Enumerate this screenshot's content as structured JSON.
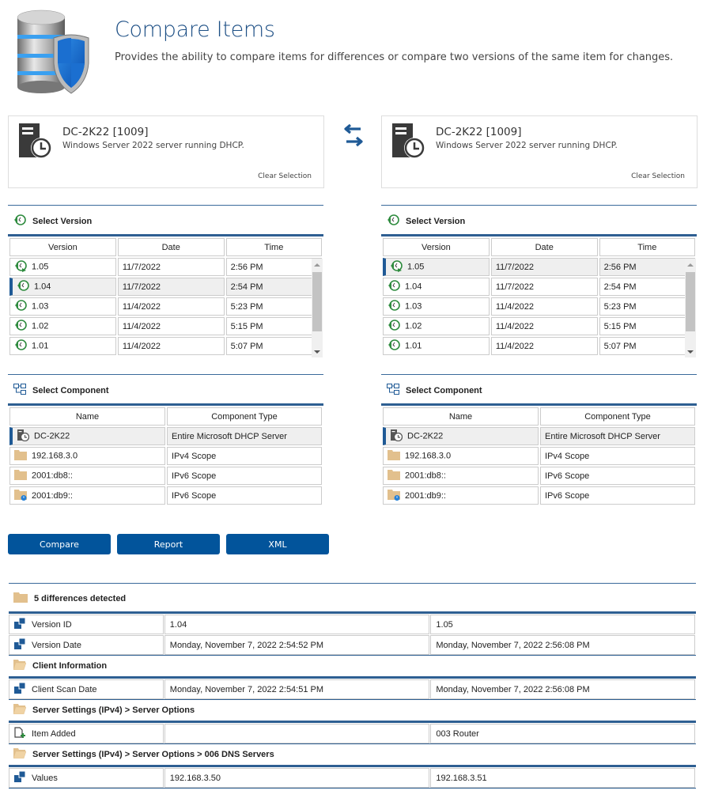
{
  "header": {
    "title": "Compare Items",
    "subtitle": "Provides the ability to compare items for differences or compare two versions of the same item for changes."
  },
  "left_item": {
    "name": "DC-2K22 [1009]",
    "description": "Windows Server 2022 server running DHCP.",
    "clear_label": "Clear Selection"
  },
  "right_item": {
    "name": "DC-2K22 [1009]",
    "description": "Windows Server 2022 server running DHCP.",
    "clear_label": "Clear Selection"
  },
  "swap_icon": "swap-arrows-icon",
  "select_version": {
    "title": "Select Version",
    "columns": [
      "Version",
      "Date",
      "Time"
    ],
    "rows": [
      {
        "version": "1.05",
        "date": "11/7/2022",
        "time": "2:56 PM"
      },
      {
        "version": "1.04",
        "date": "11/7/2022",
        "time": "2:54 PM"
      },
      {
        "version": "1.03",
        "date": "11/4/2022",
        "time": "5:23 PM"
      },
      {
        "version": "1.02",
        "date": "11/4/2022",
        "time": "5:15 PM"
      },
      {
        "version": "1.01",
        "date": "11/4/2022",
        "time": "5:07 PM"
      }
    ],
    "left_selected": "1.04",
    "right_selected": "1.05"
  },
  "select_component": {
    "title": "Select Component",
    "columns": [
      "Name",
      "Component Type"
    ],
    "rows": [
      {
        "name": "DC-2K22",
        "type": "Entire Microsoft DHCP Server",
        "icon": "server-clock-icon"
      },
      {
        "name": "192.168.3.0",
        "type": "IPv4 Scope",
        "icon": "folder-icon"
      },
      {
        "name": "2001:db8::",
        "type": "IPv6 Scope",
        "icon": "folder-icon"
      },
      {
        "name": "2001:db9::",
        "type": "IPv6 Scope",
        "icon": "folder-power-icon"
      }
    ],
    "left_selected": "DC-2K22",
    "right_selected": "DC-2K22"
  },
  "buttons": {
    "compare": "Compare",
    "report": "Report",
    "xml": "XML"
  },
  "results": {
    "summary": "5 differences detected",
    "groups": [
      {
        "title": null,
        "rows": [
          {
            "label": "Version ID",
            "left": "1.04",
            "right": "1.05",
            "icon": "property-icon"
          },
          {
            "label": "Version Date",
            "left": "Monday, November 7, 2022 2:54:52 PM",
            "right": "Monday, November 7, 2022 2:56:08 PM",
            "icon": "property-icon"
          }
        ]
      },
      {
        "title": "Client Information",
        "rows": [
          {
            "label": "Client Scan Date",
            "left": "Monday, November 7, 2022 2:54:51 PM",
            "right": "Monday, November 7, 2022 2:56:08 PM",
            "icon": "property-icon"
          }
        ]
      },
      {
        "title": "Server Settings (IPv4) > Server Options",
        "rows": [
          {
            "label": "Item Added",
            "left": "",
            "right": "003 Router",
            "icon": "item-added-icon"
          }
        ]
      },
      {
        "title": "Server Settings (IPv4) > Server Options > 006 DNS Servers",
        "rows": [
          {
            "label": "Values",
            "left": "192.168.3.50",
            "right": "192.168.3.51",
            "icon": "property-icon"
          }
        ]
      }
    ]
  },
  "colors": {
    "accent": "#02549b",
    "title": "#1d4f85",
    "section_line": "#2e5f92",
    "selected_row": "#efefef",
    "folder": "#e2c08d",
    "version_icon": "#2e8b3e"
  }
}
